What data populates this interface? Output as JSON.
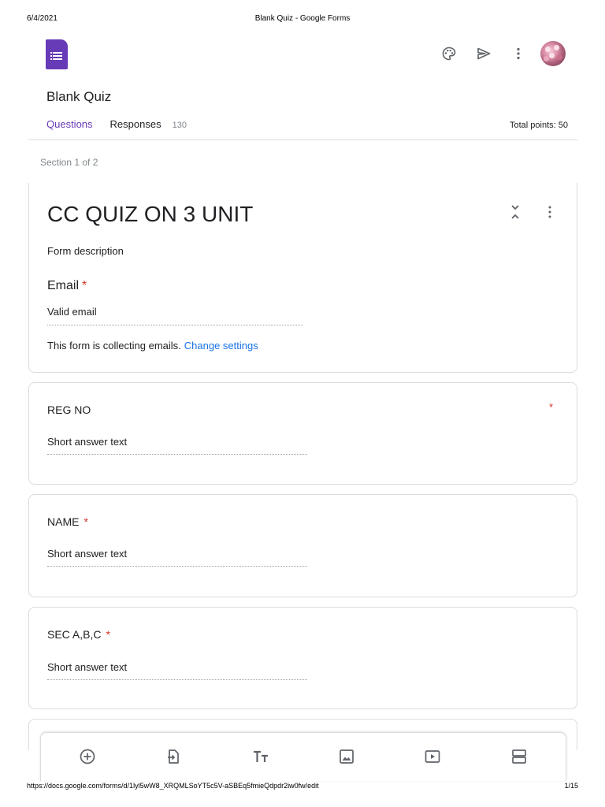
{
  "print": {
    "date": "6/4/2021",
    "window_title": "Blank Quiz - Google Forms",
    "url": "https://docs.google.com/forms/d/1lyl5wW8_XRQMLSoYT5c5V-aSBEq5fmieQdpdr2iw0fw/edit",
    "page": "1/15"
  },
  "header": {
    "form_title": "Blank Quiz",
    "icons": [
      "forms-logo-icon",
      "palette-icon",
      "send-icon",
      "more-vert-icon",
      "avatar"
    ]
  },
  "tabs": {
    "questions_label": "Questions",
    "responses_label": "Responses",
    "responses_count": "130",
    "total_points": "Total points: 50"
  },
  "section": {
    "label": "Section 1 of 2"
  },
  "form_header": {
    "title": "CC QUIZ ON 3 UNIT",
    "description": "Form description",
    "email_label": "Email",
    "email_required": "*",
    "email_placeholder": "Valid email",
    "collecting_note": "This form is collecting emails.",
    "change_settings": "Change settings"
  },
  "questions": [
    {
      "title": "REG NO",
      "required": "*",
      "answer_placeholder": "Short answer text"
    },
    {
      "title": "NAME",
      "required": "*",
      "answer_placeholder": "Short answer text"
    },
    {
      "title": "SEC A,B,C",
      "required": "*",
      "answer_placeholder": "Short answer text"
    }
  ],
  "toolbar": {
    "tools": [
      "add-question-icon",
      "import-questions-icon",
      "add-title-icon",
      "add-image-icon",
      "add-video-icon",
      "add-section-icon"
    ]
  },
  "colors": {
    "accent": "#673ab7",
    "link": "#1a73e8",
    "required": "#d93025",
    "muted": "#80868b",
    "border": "#dadce0"
  }
}
